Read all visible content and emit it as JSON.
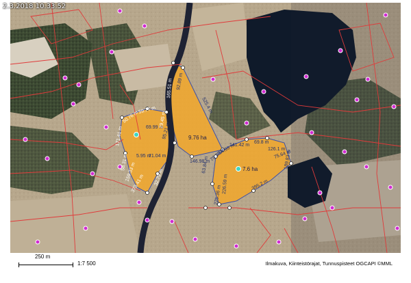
{
  "map": {
    "timestamp": "2.3.2018 10.33.52",
    "scale_label": "250 m",
    "scale_ratio": "1:7 500",
    "attribution": "Ilmakuva, Kiinteistörajat, Tunnuspisteet OGCAPI ©MML",
    "colors": {
      "parcel_fill": "#f2a72a",
      "boundary_red": "#e03a3a",
      "marker_purple": "#d12bd1",
      "water": "#0f1a2a",
      "field": "#b9a98f",
      "forest": "#3c4a32",
      "river": "#1e2233"
    },
    "areas": [
      {
        "label": "9.76 ha"
      },
      {
        "label": "7.6 ha"
      }
    ],
    "measurements": [
      "59.77 m",
      "50.76 m",
      "171.41 m",
      "69.99 m",
      "5.95 m",
      "71.04 m",
      "95.21 m",
      "58.31 m",
      "159.33 m",
      "373.41 m",
      "32.79 m",
      "29.45 m",
      "165.51 m",
      "146.98 m",
      "525.4 m",
      "92.89 m",
      "79.38 m",
      "54.99 m",
      "141.42 m",
      "69.8 m",
      "126.1 m",
      "75.64 m",
      "189.83 m",
      "226.59 m",
      "225.36 m",
      "395.2 m",
      "63.84 m"
    ]
  }
}
